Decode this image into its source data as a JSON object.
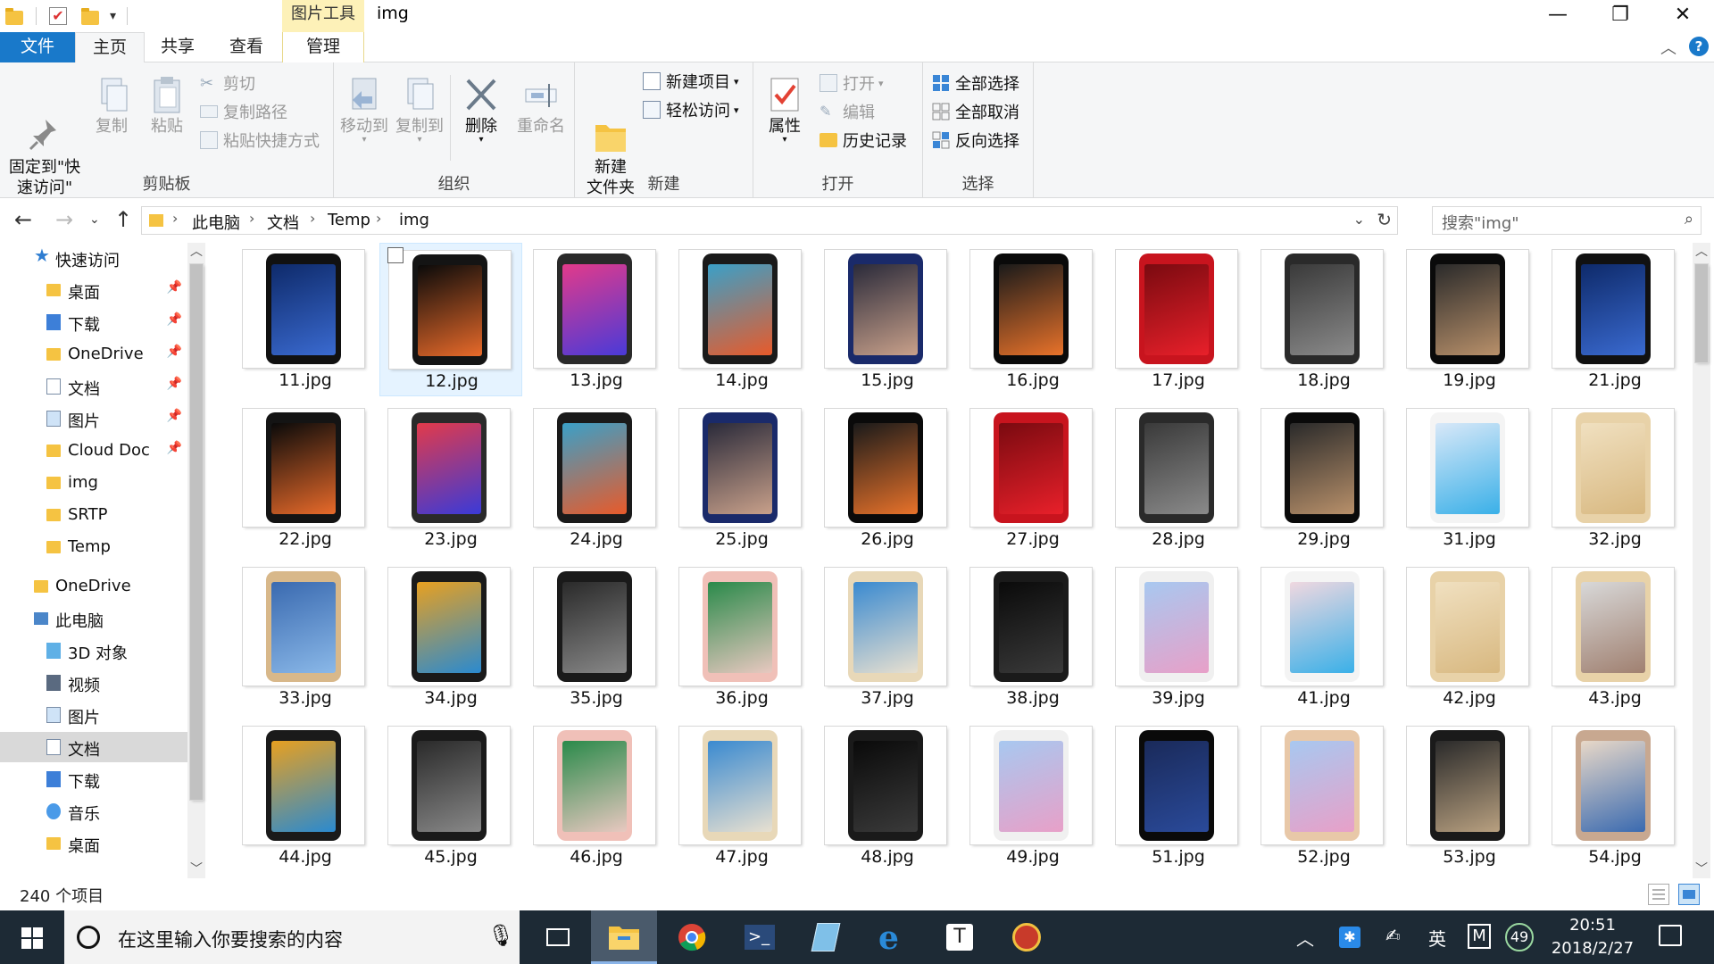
{
  "titlebar": {
    "context_tab": "图片工具",
    "title": "img"
  },
  "tabs": {
    "file": "文件",
    "home": "主页",
    "share": "共享",
    "view": "查看",
    "manage": "管理"
  },
  "ribbon": {
    "clipboard": {
      "label": "剪贴板",
      "pin": "固定到\"快\n速访问\"",
      "copy": "复制",
      "paste": "粘贴",
      "cut": "剪切",
      "copy_path": "复制路径",
      "paste_shortcut": "粘贴快捷方式"
    },
    "organize": {
      "label": "组织",
      "move_to": "移动到",
      "copy_to": "复制到",
      "delete": "删除",
      "rename": "重命名"
    },
    "new": {
      "label": "新建",
      "new_folder": "新建\n文件夹",
      "new_item": "新建项目",
      "easy_access": "轻松访问"
    },
    "open": {
      "label": "打开",
      "properties": "属性",
      "open": "打开",
      "edit": "编辑",
      "history": "历史记录"
    },
    "select": {
      "label": "选择",
      "select_all": "全部选择",
      "select_none": "全部取消",
      "invert": "反向选择"
    }
  },
  "address": {
    "crumbs": [
      "此电脑",
      "文档",
      "Temp",
      "img"
    ],
    "search_placeholder": "搜索\"img\""
  },
  "navpane": {
    "items": [
      {
        "label": "快速访问",
        "icon": "star-icon",
        "pinned": false,
        "indent": 0
      },
      {
        "label": "桌面",
        "icon": "folder-icon",
        "pinned": true,
        "indent": 1
      },
      {
        "label": "下载",
        "icon": "download-icon",
        "pinned": true,
        "indent": 1
      },
      {
        "label": "OneDrive",
        "icon": "folder-icon",
        "pinned": true,
        "indent": 1
      },
      {
        "label": "文档",
        "icon": "document-icon",
        "pinned": true,
        "indent": 1
      },
      {
        "label": "图片",
        "icon": "pictures-icon",
        "pinned": true,
        "indent": 1
      },
      {
        "label": "Cloud Doc",
        "icon": "folder-icon",
        "pinned": true,
        "indent": 1
      },
      {
        "label": "img",
        "icon": "folder-icon",
        "pinned": false,
        "indent": 1
      },
      {
        "label": "SRTP",
        "icon": "folder-icon",
        "pinned": false,
        "indent": 1
      },
      {
        "label": "Temp",
        "icon": "folder-icon",
        "pinned": false,
        "indent": 1
      },
      {
        "label": "OneDrive",
        "icon": "cloud-folder-icon",
        "pinned": false,
        "indent": 0
      },
      {
        "label": "此电脑",
        "icon": "computer-icon",
        "pinned": false,
        "indent": 0
      },
      {
        "label": "3D 对象",
        "icon": "3d-objects-icon",
        "pinned": false,
        "indent": 1
      },
      {
        "label": "视频",
        "icon": "video-icon",
        "pinned": false,
        "indent": 1
      },
      {
        "label": "图片",
        "icon": "pictures-icon",
        "pinned": false,
        "indent": 1
      },
      {
        "label": "文档",
        "icon": "document-icon",
        "pinned": false,
        "indent": 1,
        "selected": true
      },
      {
        "label": "下载",
        "icon": "download-icon",
        "pinned": false,
        "indent": 1
      },
      {
        "label": "音乐",
        "icon": "music-icon",
        "pinned": false,
        "indent": 1
      },
      {
        "label": "桌面",
        "icon": "folder-icon",
        "pinned": false,
        "indent": 1
      }
    ]
  },
  "files": [
    {
      "name": "11.jpg",
      "body": "#111111",
      "screen": "#0e2a6a",
      "accent": "#3a6ad0"
    },
    {
      "name": "12.jpg",
      "body": "#141414",
      "screen": "#0a0a0a",
      "accent": "#e86a2a",
      "hover": true
    },
    {
      "name": "13.jpg",
      "body": "#2a2a2a",
      "screen": "#e23a8a",
      "accent": "#4a3ad8"
    },
    {
      "name": "14.jpg",
      "body": "#1a1a1a",
      "screen": "#3aa0c8",
      "accent": "#e85a2a"
    },
    {
      "name": "15.jpg",
      "body": "#1a2a6a",
      "screen": "#2a2a3a",
      "accent": "#c8a08a"
    },
    {
      "name": "16.jpg",
      "body": "#0a0a0a",
      "screen": "#1a1a1a",
      "accent": "#e8722a"
    },
    {
      "name": "17.jpg",
      "body": "#c8141e",
      "screen": "#7a0a10",
      "accent": "#e8202a"
    },
    {
      "name": "18.jpg",
      "body": "#2a2a2a",
      "screen": "#3a3a3a",
      "accent": "#8a8a8a"
    },
    {
      "name": "19.jpg",
      "body": "#0a0a0a",
      "screen": "#2a2a2a",
      "accent": "#b8906a"
    },
    {
      "name": "21.jpg",
      "body": "#111111",
      "screen": "#0e2a6a",
      "accent": "#3a6ad0"
    },
    {
      "name": "22.jpg",
      "body": "#141414",
      "screen": "#0a0a0a",
      "accent": "#e86a2a"
    },
    {
      "name": "23.jpg",
      "body": "#2a2a2a",
      "screen": "#e23a4a",
      "accent": "#3a3ad8"
    },
    {
      "name": "24.jpg",
      "body": "#1a1a1a",
      "screen": "#3aa0c8",
      "accent": "#e85a2a"
    },
    {
      "name": "25.jpg",
      "body": "#1a2a6a",
      "screen": "#2a2a3a",
      "accent": "#c8a08a"
    },
    {
      "name": "26.jpg",
      "body": "#0a0a0a",
      "screen": "#1a1a1a",
      "accent": "#e8722a"
    },
    {
      "name": "27.jpg",
      "body": "#c8141e",
      "screen": "#7a0a10",
      "accent": "#e8202a"
    },
    {
      "name": "28.jpg",
      "body": "#2a2a2a",
      "screen": "#3a3a3a",
      "accent": "#8a8a8a"
    },
    {
      "name": "29.jpg",
      "body": "#0a0a0a",
      "screen": "#2a2a2a",
      "accent": "#b8906a"
    },
    {
      "name": "31.jpg",
      "body": "#f4f4f4",
      "screen": "#d8e8f8",
      "accent": "#3ab0e8"
    },
    {
      "name": "32.jpg",
      "body": "#e8d2a8",
      "screen": "#f0e0c0",
      "accent": "#d8b880"
    },
    {
      "name": "33.jpg",
      "body": "#d8b88a",
      "screen": "#3a6ab0",
      "accent": "#8ab8e8"
    },
    {
      "name": "34.jpg",
      "body": "#1a1a1a",
      "screen": "#e8a020",
      "accent": "#2a8ad0"
    },
    {
      "name": "35.jpg",
      "body": "#1a1a1a",
      "screen": "#2a2a2a",
      "accent": "#888888"
    },
    {
      "name": "36.jpg",
      "body": "#f0c0b8",
      "screen": "#2a8a4a",
      "accent": "#e8c8c0"
    },
    {
      "name": "37.jpg",
      "body": "#e8d8b8",
      "screen": "#3a8ad0",
      "accent": "#e8e0d0"
    },
    {
      "name": "38.jpg",
      "body": "#1a1a1a",
      "screen": "#0a0a0a",
      "accent": "#3a3a3a"
    },
    {
      "name": "39.jpg",
      "body": "#f0f0f0",
      "screen": "#a8c8f0",
      "accent": "#e8a0c8"
    },
    {
      "name": "41.jpg",
      "body": "#f4f4f4",
      "screen": "#f0d8e0",
      "accent": "#3ab0e8"
    },
    {
      "name": "42.jpg",
      "body": "#e8d2a8",
      "screen": "#f0e0c0",
      "accent": "#d8b880"
    },
    {
      "name": "43.jpg",
      "body": "#e8d2a8",
      "screen": "#d8d8d8",
      "accent": "#a08070"
    },
    {
      "name": "44.jpg",
      "body": "#1a1a1a",
      "screen": "#e8a020",
      "accent": "#2a8ad0"
    },
    {
      "name": "45.jpg",
      "body": "#1a1a1a",
      "screen": "#2a2a2a",
      "accent": "#888888"
    },
    {
      "name": "46.jpg",
      "body": "#f0c0b8",
      "screen": "#2a8a4a",
      "accent": "#e8c8c0"
    },
    {
      "name": "47.jpg",
      "body": "#e8d8b8",
      "screen": "#3a8ad0",
      "accent": "#e8e0d0"
    },
    {
      "name": "48.jpg",
      "body": "#1a1a1a",
      "screen": "#0a0a0a",
      "accent": "#3a3a3a"
    },
    {
      "name": "49.jpg",
      "body": "#f0f0f0",
      "screen": "#a8c8f0",
      "accent": "#e8a0c8"
    },
    {
      "name": "51.jpg",
      "body": "#0a0a0a",
      "screen": "#1a2a5a",
      "accent": "#2a4a9a"
    },
    {
      "name": "52.jpg",
      "body": "#e8c8a8",
      "screen": "#a8c8f0",
      "accent": "#e8a0c8"
    },
    {
      "name": "53.jpg",
      "body": "#1a1a1a",
      "screen": "#2a2a2a",
      "accent": "#b8a080"
    },
    {
      "name": "54.jpg",
      "body": "#c8a890",
      "screen": "#e8d8c8",
      "accent": "#3a6ab0"
    }
  ],
  "status": {
    "count": "240 个项目"
  },
  "taskbar": {
    "search_placeholder": "在这里输入你要搜索的内容",
    "ime": "英",
    "ime_mode": "M",
    "badge": "49",
    "time": "20:51",
    "date": "2018/2/27"
  }
}
